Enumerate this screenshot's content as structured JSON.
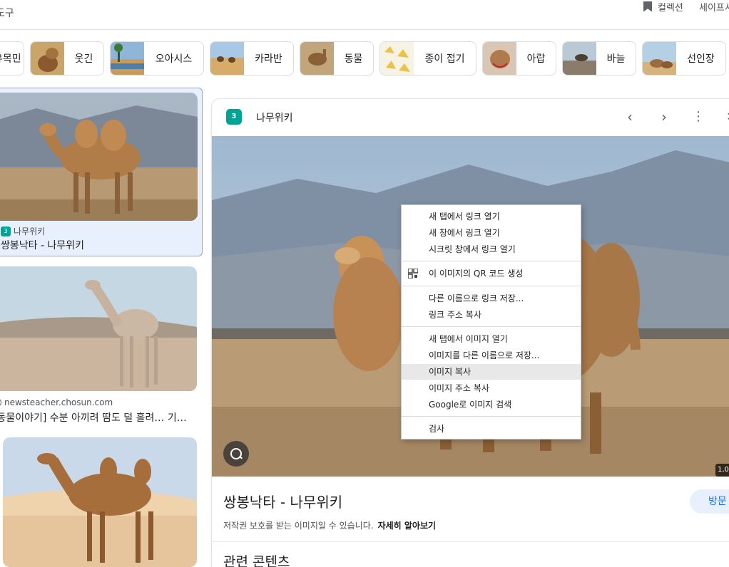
{
  "header": {
    "tools_label": "도구",
    "collections_label": "컬렉션",
    "safesearch_label": "세이프서치"
  },
  "chips": [
    {
      "label": "유목민"
    },
    {
      "label": "웃긴"
    },
    {
      "label": "오아시스"
    },
    {
      "label": "카라반"
    },
    {
      "label": "동물"
    },
    {
      "label": "종이 접기"
    },
    {
      "label": "아랍"
    },
    {
      "label": "바늘"
    },
    {
      "label": "선인장"
    }
  ],
  "results": [
    {
      "source": "나무위키",
      "title": "쌍봉낙타 - 나무위키"
    },
    {
      "source": "newsteacher.chosun.com",
      "title": "[동물이야기] 수분 아끼려 땀도 덜 흘려… 기…"
    }
  ],
  "panel": {
    "site_name": "나무위키",
    "title": "쌍봉낙타 - 나무위키",
    "copyright_text": "저작권 보호를 받는 이미지일 수 있습니다.",
    "learn_more": "자세히 알아보기",
    "visit_label": "방문",
    "size_label": "1,0",
    "related_label": "관련 콘텐츠"
  },
  "context_menu": {
    "items": [
      {
        "label": "새 탭에서 링크 열기"
      },
      {
        "label": "새 창에서 링크 열기"
      },
      {
        "label": "시크릿 창에서 링크 열기"
      },
      {
        "label": "이 이미지의 QR 코드 생성"
      },
      {
        "label": "다른 이름으로 링크 저장..."
      },
      {
        "label": "링크 주소 복사"
      },
      {
        "label": "새 탭에서 이미지 열기"
      },
      {
        "label": "이미지를 다른 이름으로 저장..."
      },
      {
        "label": "이미지 복사"
      },
      {
        "label": "이미지 주소 복사"
      },
      {
        "label": "Google로 이미지 검색"
      },
      {
        "label": "검사"
      }
    ]
  },
  "colors": {
    "accent": "#1a73e8",
    "selected_bg": "#e8f0fe",
    "menu_highlight": "#e8e8e8"
  }
}
